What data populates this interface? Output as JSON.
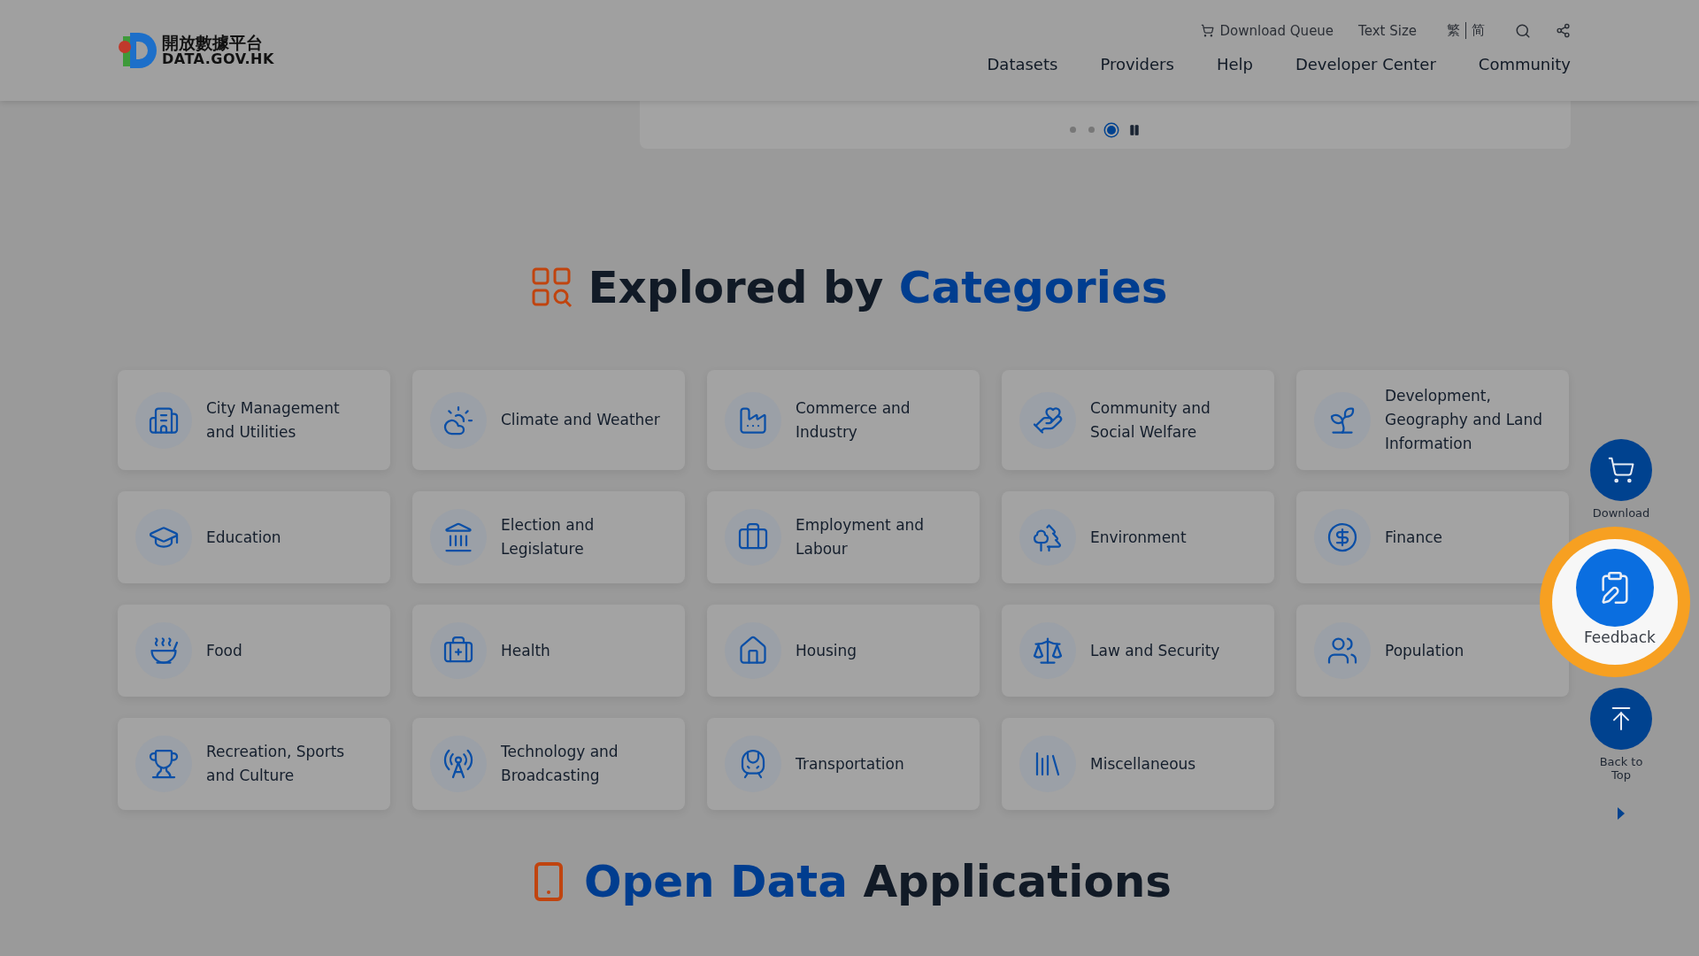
{
  "header": {
    "logo": {
      "chinese": "開放數據平台",
      "english": "DATA.GOV.HK"
    },
    "utility": {
      "download_queue": "Download Queue",
      "text_size": "Text Size",
      "languages": [
        "繁",
        "简"
      ]
    },
    "nav": [
      "Datasets",
      "Providers",
      "Help",
      "Developer Center",
      "Community"
    ]
  },
  "carousel": {
    "dots": [
      {
        "selected": false
      },
      {
        "selected": false
      },
      {
        "selected": true
      }
    ]
  },
  "categories_section": {
    "title_start": "Explored by",
    "title_highlight": "Categories",
    "items": [
      {
        "label": "City Management and Utilities"
      },
      {
        "label": "Climate and Weather"
      },
      {
        "label": "Commerce and Industry"
      },
      {
        "label": "Community and Social Welfare"
      },
      {
        "label": "Development, Geography and Land Information"
      },
      {
        "label": "Education"
      },
      {
        "label": "Election and Legislature"
      },
      {
        "label": "Employment and Labour"
      },
      {
        "label": "Environment"
      },
      {
        "label": "Finance"
      },
      {
        "label": "Food"
      },
      {
        "label": "Health"
      },
      {
        "label": "Housing"
      },
      {
        "label": "Law and Security"
      },
      {
        "label": "Population"
      },
      {
        "label": "Recreation, Sports and Culture"
      },
      {
        "label": "Technology and Broadcasting"
      },
      {
        "label": "Transportation"
      },
      {
        "label": "Miscellaneous"
      }
    ]
  },
  "side_buttons": [
    {
      "kind": "download",
      "label": "Download",
      "highlighted": false
    },
    {
      "kind": "feedback",
      "label": "Feedback",
      "highlighted": true
    },
    {
      "kind": "top",
      "label": "Back to Top",
      "highlighted": false
    }
  ],
  "next_section": {
    "title_highlight": "Open Data",
    "title_end": "Applications"
  }
}
